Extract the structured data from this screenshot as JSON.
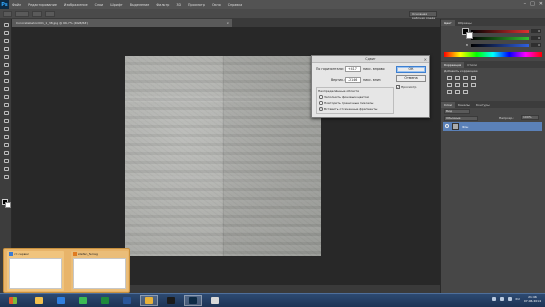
{
  "app": {
    "logo": "Ps",
    "menu": [
      "Файл",
      "Редактирование",
      "Изображение",
      "Слои",
      "Шрифт",
      "Выделение",
      "Фильтр",
      "3D",
      "Просмотр",
      "Окно",
      "Справка"
    ],
    "window_controls": [
      "–",
      "□",
      "✕"
    ],
    "workspace": "Основная рабочая среда"
  },
  "document": {
    "tab_title": "Concretebeton001_1_38.jpg @ 66,7% (RGB/8#)",
    "zoom_status": "66,67%",
    "status_text": "Док: 3,00M/3,00M"
  },
  "dialog": {
    "title": "Сдвиг",
    "horizontal_label": "По горизонтали:",
    "horizontal_value": "+417",
    "horizontal_unit": "пикс. вправо",
    "vertical_label": "Вертик.:",
    "vertical_value": "-2146",
    "vertical_unit": "пикс. вниз",
    "group_title": "Неопределённые области",
    "options": [
      {
        "label": "Заполнить фоновым цветом",
        "checked": false
      },
      {
        "label": "Повторить граничные пикселы",
        "checked": false
      },
      {
        "label": "Вставить отсеченные фрагменты",
        "checked": true
      }
    ],
    "ok_label": "ОК",
    "cancel_label": "Отмена",
    "preview_label": "Просмотр",
    "preview_checked": true
  },
  "panels": {
    "color_tabs": [
      "Цвет",
      "Образцы"
    ],
    "sliders": [
      {
        "label": "R",
        "value": "0",
        "color": "#e03030"
      },
      {
        "label": "G",
        "value": "0",
        "color": "#30c030"
      },
      {
        "label": "B",
        "value": "0",
        "color": "#3060e0"
      }
    ],
    "adjust_tabs": [
      "Коррекция",
      "Стили"
    ],
    "adjust_title": "Добавить коррекцию",
    "layers_tabs": [
      "Слои",
      "Каналы",
      "Контуры"
    ],
    "layer_kind": "Вид",
    "blend_mode": "Обычные",
    "opacity_label": "Непрозр.:",
    "opacity_value": "100%",
    "fill_label": "Заливка:",
    "fill_value": "100%",
    "lock_label": "Закрепить:",
    "layer_name": "Фон"
  },
  "taskbar_thumbs": [
    {
      "title": "ст.сервис",
      "icon_color": "#3a7bd5"
    },
    {
      "title": "stefan_ferreg",
      "icon_color": "#e07b20"
    }
  ],
  "taskbar": {
    "apps": [
      {
        "name": "explorer-icon",
        "color": "#f2c14e",
        "active": false
      },
      {
        "name": "ie-icon",
        "color": "#2f7fe0",
        "active": false
      },
      {
        "name": "chrome-icon",
        "color": "#3cba54",
        "active": false
      },
      {
        "name": "excel-icon",
        "color": "#1f8a3b",
        "active": false
      },
      {
        "name": "word-icon",
        "color": "#2a5699",
        "active": false
      },
      {
        "name": "folder-icon",
        "color": "#e8b23a",
        "active": true
      },
      {
        "name": "media-icon",
        "color": "#1b1b1b",
        "active": false
      },
      {
        "name": "photoshop-icon",
        "color": "#0d2a44",
        "active": true
      },
      {
        "name": "paint-icon",
        "color": "#d8d8d8",
        "active": false
      }
    ],
    "lang": "RU",
    "time": "21:46",
    "date": "07.06.2014"
  },
  "colors": {
    "accent": "#5b81b8",
    "dialog_bg": "#e6e6e6",
    "thumb_popup": "#e8b46a"
  }
}
